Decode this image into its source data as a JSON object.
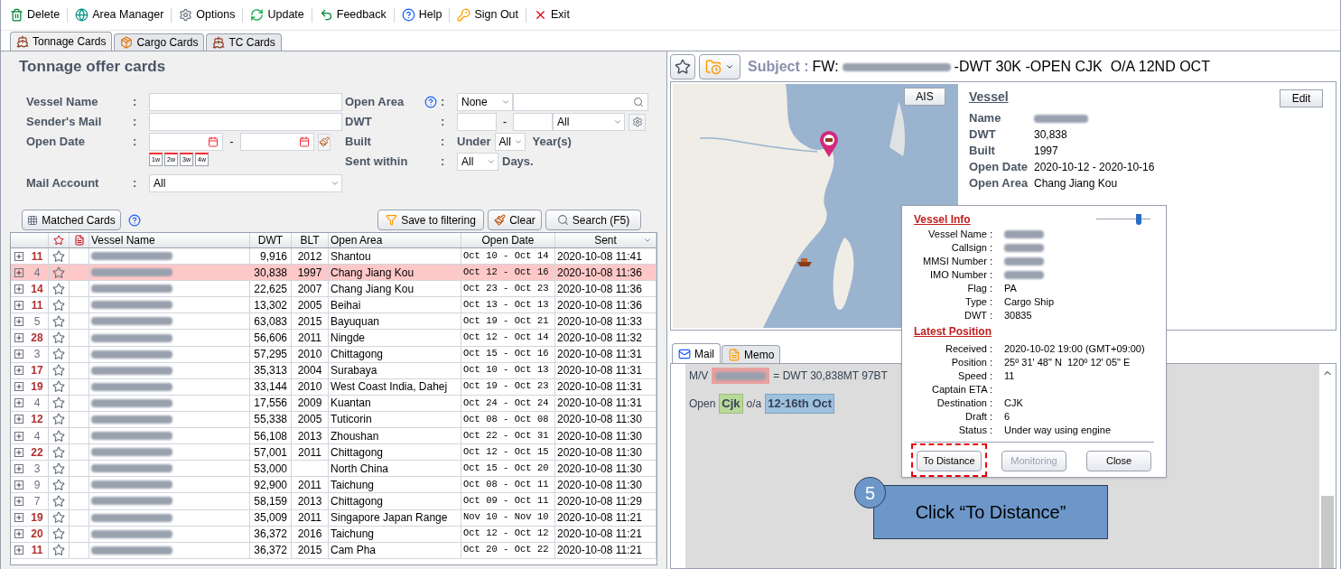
{
  "toolbar": [
    {
      "kind": "delete",
      "label": "Delete"
    },
    {
      "kind": "globe",
      "label": "Area Manager"
    },
    {
      "kind": "gear",
      "label": "Options"
    },
    {
      "kind": "refresh",
      "label": "Update"
    },
    {
      "kind": "undo",
      "label": "Feedback"
    },
    {
      "kind": "help",
      "label": "Help"
    },
    {
      "kind": "keys",
      "label": "Sign Out"
    },
    {
      "kind": "exit",
      "label": "Exit"
    }
  ],
  "tabs": [
    {
      "kind": "ship",
      "label": "Tonnage Cards",
      "selected": true
    },
    {
      "kind": "box",
      "label": "Cargo Cards",
      "selected": false
    },
    {
      "kind": "ship",
      "label": "TC Cards",
      "selected": false
    }
  ],
  "form": {
    "title": "Tonnage offer cards",
    "vessel_name": {
      "label": "Vessel Name"
    },
    "senders_mail": {
      "label": "Sender's Mail"
    },
    "open_date": {
      "label": "Open Date",
      "separator": "-",
      "quick": [
        "1w",
        "2w",
        "3w",
        "4w"
      ]
    },
    "mail_account": {
      "label": "Mail Account",
      "value": "All"
    },
    "open_area": {
      "label": "Open Area",
      "select": "None"
    },
    "dwt": {
      "label": "DWT",
      "separator": "-",
      "select": "All"
    },
    "built": {
      "label": "Built",
      "prefix": "Under",
      "select": "All",
      "suffix": "Year(s)"
    },
    "sent_within": {
      "label": "Sent within",
      "select": "All",
      "suffix": "Days."
    },
    "colon": ":"
  },
  "actions": {
    "matched": "Matched Cards",
    "save": "Save to filtering",
    "clear": "Clear",
    "search": "Search (F5)"
  },
  "table": {
    "columns": [
      "Vessel Name",
      "DWT",
      "BLT",
      "Open Area",
      "Open Date",
      "Sent"
    ],
    "rows": [
      {
        "count": "11",
        "emphasized": true,
        "selected": false,
        "dwt": "9,916",
        "blt": "2012",
        "area": "Shantou",
        "open": "Oct 10 - Oct 14",
        "sent": "2020-10-08 11:41"
      },
      {
        "count": "4",
        "emphasized": false,
        "selected": true,
        "dwt": "30,838",
        "blt": "1997",
        "area": "Chang Jiang Kou",
        "open": "Oct 12 - Oct 16",
        "sent": "2020-10-08 11:36"
      },
      {
        "count": "14",
        "emphasized": true,
        "selected": false,
        "dwt": "22,625",
        "blt": "2007",
        "area": "Chang Jiang Kou",
        "open": "Oct 23 - Oct 23",
        "sent": "2020-10-08 11:36"
      },
      {
        "count": "11",
        "emphasized": true,
        "selected": false,
        "dwt": "13,302",
        "blt": "2005",
        "area": "Beihai",
        "open": "Oct 13 - Oct 13",
        "sent": "2020-10-08 11:36"
      },
      {
        "count": "5",
        "emphasized": false,
        "selected": false,
        "dwt": "63,083",
        "blt": "2015",
        "area": "Bayuquan",
        "open": "Oct 19 - Oct 21",
        "sent": "2020-10-08 11:33"
      },
      {
        "count": "28",
        "emphasized": true,
        "selected": false,
        "dwt": "56,606",
        "blt": "2011",
        "area": "Ningde",
        "open": "Oct 12 - Oct 14",
        "sent": "2020-10-08 11:32"
      },
      {
        "count": "3",
        "emphasized": false,
        "selected": false,
        "dwt": "57,295",
        "blt": "2010",
        "area": "Chittagong",
        "open": "Oct 15 - Oct 16",
        "sent": "2020-10-08 11:31"
      },
      {
        "count": "17",
        "emphasized": true,
        "selected": false,
        "dwt": "35,313",
        "blt": "2004",
        "area": "Surabaya",
        "open": "Oct 10 - Oct 13",
        "sent": "2020-10-08 11:31"
      },
      {
        "count": "19",
        "emphasized": true,
        "selected": false,
        "dwt": "33,144",
        "blt": "2010",
        "area": "West Coast India, Dahej",
        "open": "Oct 19 - Oct 23",
        "sent": "2020-10-08 11:31"
      },
      {
        "count": "4",
        "emphasized": false,
        "selected": false,
        "dwt": "17,556",
        "blt": "2009",
        "area": "Kuantan",
        "open": "Oct 24 - Oct 24",
        "sent": "2020-10-08 11:31"
      },
      {
        "count": "12",
        "emphasized": true,
        "selected": false,
        "dwt": "55,338",
        "blt": "2005",
        "area": "Tuticorin",
        "open": "Oct 08 - Oct 08",
        "sent": "2020-10-08 11:30"
      },
      {
        "count": "4",
        "emphasized": false,
        "selected": false,
        "dwt": "56,108",
        "blt": "2013",
        "area": "Zhoushan",
        "open": "Oct 22 - Oct 31",
        "sent": "2020-10-08 11:30"
      },
      {
        "count": "22",
        "emphasized": true,
        "selected": false,
        "dwt": "57,001",
        "blt": "2011",
        "area": "Chittagong",
        "open": "Oct 12 - Oct 15",
        "sent": "2020-10-08 11:30"
      },
      {
        "count": "3",
        "emphasized": false,
        "selected": false,
        "dwt": "53,000",
        "area": "North China",
        "open": "Oct 15 - Oct 20",
        "sent": "2020-10-08 11:30"
      },
      {
        "count": "9",
        "emphasized": false,
        "selected": false,
        "dwt": "92,900",
        "blt": "2011",
        "area": "Taichung",
        "open": "Oct 08 - Oct 11",
        "sent": "2020-10-08 11:30"
      },
      {
        "count": "7",
        "emphasized": false,
        "selected": false,
        "dwt": "58,159",
        "blt": "2013",
        "area": "Chittagong",
        "open": "Oct 09 - Oct 11",
        "sent": "2020-10-08 11:29"
      },
      {
        "count": "19",
        "emphasized": true,
        "selected": false,
        "dwt": "35,009",
        "blt": "2011",
        "area": "Singapore Japan Range",
        "open": "Nov 10 - Nov 10",
        "sent": "2020-10-08 11:21"
      },
      {
        "count": "20",
        "emphasized": true,
        "selected": false,
        "dwt": "36,372",
        "blt": "2016",
        "area": "Taichung",
        "open": "Oct 12 - Oct 12",
        "sent": "2020-10-08 11:21"
      },
      {
        "count": "11",
        "emphasized": true,
        "selected": false,
        "dwt": "36,372",
        "blt": "2015",
        "area": "Cam Pha",
        "open": "Oct 20 - Oct 22",
        "sent": "2020-10-08 11:21"
      }
    ]
  },
  "subject": {
    "label": "Subject :",
    "prefix": "FW:",
    "suffix": "-DWT 30K -OPEN CJK  O/A 12ND OCT"
  },
  "vessel": {
    "heading": "Vessel",
    "edit": "Edit",
    "ais": "AIS",
    "fields": [
      {
        "label": "Name",
        "redacted": true
      },
      {
        "label": "DWT",
        "value": "30,838"
      },
      {
        "label": "Built",
        "value": "1997"
      },
      {
        "label": "Open Date",
        "value": "2020-10-12 - 2020-10-16"
      },
      {
        "label": "Open Area",
        "value": "Chang Jiang Kou"
      }
    ]
  },
  "mail_tabs": [
    {
      "kind": "mail",
      "label": "Mail",
      "selected": true
    },
    {
      "kind": "memo",
      "label": "Memo",
      "selected": false
    }
  ],
  "mail": {
    "line1_prefix": "M/V",
    "line1_suffix": "= DWT 30,838MT 97BT",
    "line2_prefix": "Open",
    "area": "Cjk",
    "oa": "o/a",
    "dates": "12-16th Oct"
  },
  "popup": {
    "info_title": "Vessel Info",
    "opacity_slider": {
      "level": 0.78
    },
    "info": [
      {
        "label": "Vessel Name :",
        "redacted": true
      },
      {
        "label": "Callsign :",
        "redacted": true
      },
      {
        "label": "MMSI Number :",
        "redacted": true
      },
      {
        "label": "IMO Number :",
        "redacted": true
      },
      {
        "label": "Flag :",
        "value": "PA"
      },
      {
        "label": "Type :",
        "value": "Cargo Ship"
      },
      {
        "label": "DWT :",
        "value": "30835"
      }
    ],
    "position_title": "Latest Position",
    "position": [
      {
        "label": "Received :",
        "value": "2020-10-02 19:00 (GMT+09:00)"
      },
      {
        "label": "Position :",
        "value": "25º 31' 48\" N  120º 12' 05\" E"
      },
      {
        "label": "Speed :",
        "value": "11"
      },
      {
        "label": "Captain ETA :"
      },
      {
        "label": "Destination :",
        "value": "CJK"
      },
      {
        "label": "Draft :",
        "value": "6"
      },
      {
        "label": "Status :",
        "value": "Under way using engine"
      }
    ],
    "buttons": [
      {
        "label": "To Distance",
        "disabled": false,
        "highlighted": true
      },
      {
        "label": "Monitoring",
        "disabled": true,
        "highlighted": false
      },
      {
        "label": "Close",
        "disabled": false,
        "highlighted": false
      }
    ]
  },
  "callout": {
    "step": "5",
    "text": "Click “To Distance”"
  }
}
